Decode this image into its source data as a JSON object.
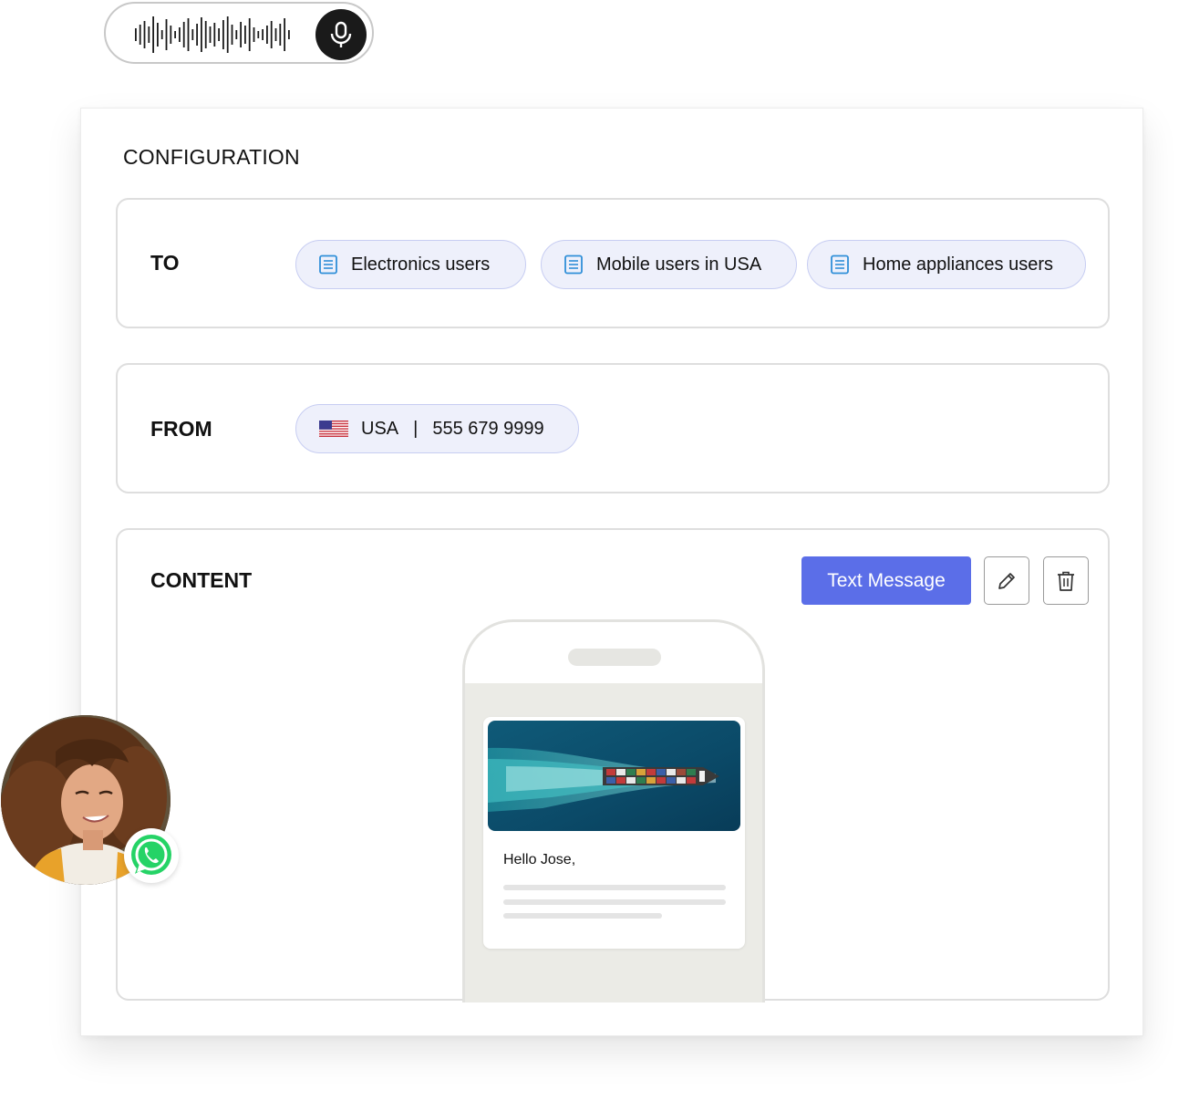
{
  "voice": {
    "waveform_icon": "audio-waveform-icon",
    "mic_icon": "microphone-icon"
  },
  "configuration": {
    "title": "CONFIGURATION",
    "to": {
      "label": "TO",
      "chips": [
        {
          "label": "Electronics users",
          "icon": "list-document-icon"
        },
        {
          "label": "Mobile users in USA",
          "icon": "list-document-icon"
        },
        {
          "label": "Home appliances users",
          "icon": "list-document-icon"
        }
      ]
    },
    "from": {
      "label": "FROM",
      "country": "USA",
      "separator": "|",
      "phone": "555 679 9999",
      "flag_icon": "us-flag-icon"
    },
    "content": {
      "label": "CONTENT",
      "text_message_button": "Text Message",
      "edit_icon": "pencil-icon",
      "delete_icon": "trash-icon",
      "preview": {
        "greeting": "Hello Jose,",
        "image": "cargo-ship-aerial-photo"
      }
    }
  },
  "badge": {
    "icon": "whatsapp-icon"
  },
  "colors": {
    "accent": "#5b6ee8",
    "chip_bg": "#eef0fb",
    "chip_border": "#c7cdf2",
    "doc_icon": "#2f8fd8",
    "whatsapp": "#25d366"
  }
}
